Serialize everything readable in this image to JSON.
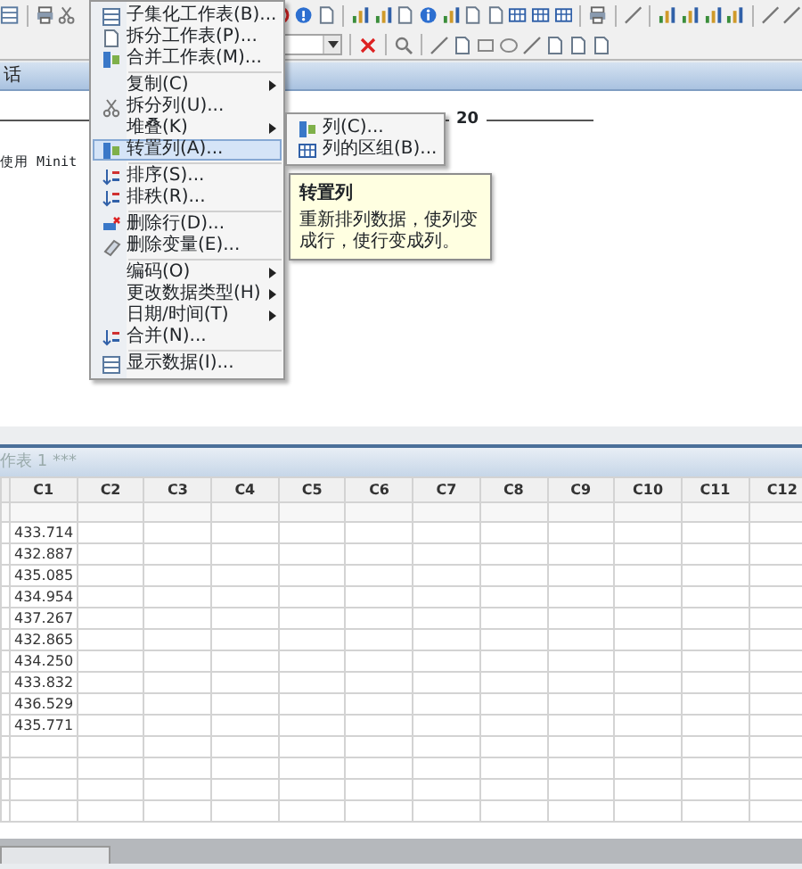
{
  "session": {
    "title": "话",
    "header_text": "20",
    "text_line": "使用 Minit"
  },
  "menu": {
    "groups": [
      [
        {
          "label": "子集化工作表(B)...",
          "arrow": false,
          "selected": false
        },
        {
          "label": "拆分工作表(P)...",
          "arrow": false,
          "selected": false
        },
        {
          "label": "合并工作表(M)...",
          "arrow": false,
          "selected": false
        }
      ],
      [
        {
          "label": "复制(C)",
          "arrow": true,
          "selected": false
        },
        {
          "label": "拆分列(U)...",
          "arrow": false,
          "selected": false
        },
        {
          "label": "堆叠(K)",
          "arrow": true,
          "selected": false,
          "submenu_items": [
            {
              "label": "列(C)..."
            },
            {
              "label": "列的区组(B)..."
            }
          ]
        },
        {
          "label": "转置列(A)...",
          "arrow": false,
          "selected": true
        }
      ],
      [
        {
          "label": "排序(S)...",
          "arrow": false,
          "selected": false
        },
        {
          "label": "排秩(R)...",
          "arrow": false,
          "selected": false
        }
      ],
      [
        {
          "label": "删除行(D)...",
          "arrow": false,
          "selected": false
        },
        {
          "label": "删除变量(E)...",
          "arrow": false,
          "selected": false
        }
      ],
      [
        {
          "label": "编码(O)",
          "arrow": true,
          "selected": false
        },
        {
          "label": "更改数据类型(H)",
          "arrow": true,
          "selected": false
        },
        {
          "label": "日期/时间(T)",
          "arrow": true,
          "selected": false
        },
        {
          "label": "合并(N)...",
          "arrow": false,
          "selected": false
        }
      ],
      [
        {
          "label": "显示数据(I)...",
          "arrow": false,
          "selected": false
        }
      ]
    ],
    "tooltip": {
      "title": "转置列",
      "text": "重新排列数据，使列变成行，使行变成列。"
    }
  },
  "worksheet": {
    "title": "作表 1 ***",
    "columns": [
      "C1",
      "C2",
      "C3",
      "C4",
      "C5",
      "C6",
      "C7",
      "C8",
      "C9",
      "C10",
      "C11",
      "C12"
    ],
    "rows": [
      [
        "433.714"
      ],
      [
        "432.887"
      ],
      [
        "435.085"
      ],
      [
        "434.954"
      ],
      [
        "437.267"
      ],
      [
        "432.865"
      ],
      [
        "434.250"
      ],
      [
        "433.832"
      ],
      [
        "436.529"
      ],
      [
        "435.771"
      ]
    ]
  }
}
